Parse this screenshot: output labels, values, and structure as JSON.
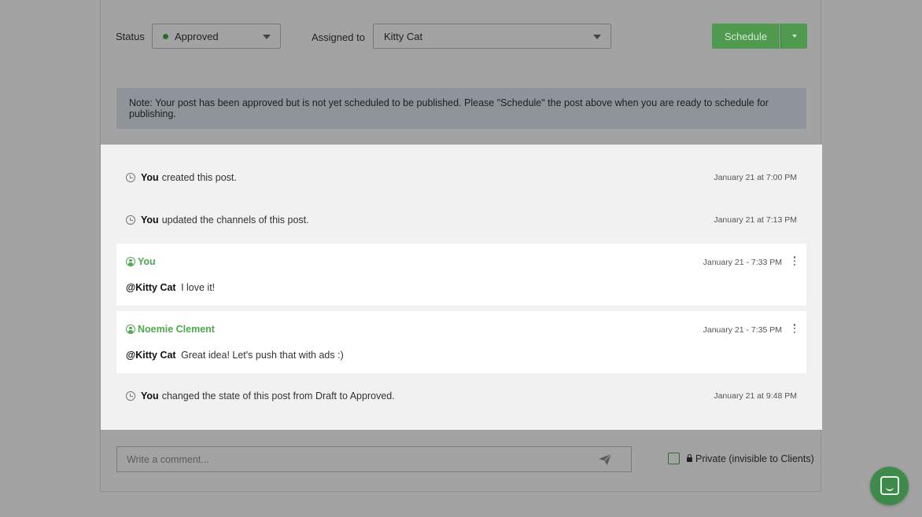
{
  "toolbar": {
    "status_label": "Status",
    "status_value": "Approved",
    "status_color": "#2f6b2f",
    "assigned_label": "Assigned to",
    "assigned_value": "Kitty Cat",
    "schedule_label": "Schedule"
  },
  "note": {
    "text": "Note: Your post has been approved but is not yet scheduled to be published. Please \"Schedule\" the post above when you are ready to schedule for publishing."
  },
  "activity": [
    {
      "actor": "You",
      "text": "created this post.",
      "time": "January 21 at 7:00 PM"
    },
    {
      "actor": "You",
      "text": "updated the channels of this post.",
      "time": "January 21 at 7:13 PM"
    }
  ],
  "comments": [
    {
      "author": "You",
      "time": "January 21 - 7:33 PM",
      "mention": "@Kitty Cat",
      "text": "I love it!"
    },
    {
      "author": "Noemie Clement",
      "time": "January 21 - 7:35 PM",
      "mention": "@Kitty Cat",
      "text": "Great idea! Let's push that with ads :)"
    }
  ],
  "state_change": {
    "actor": "You",
    "text": "changed the state of this post from Draft to Approved.",
    "time": "January 21 at 9:48 PM"
  },
  "composer": {
    "placeholder": "Write a comment...",
    "private_label": "Private (invisible to Clients)"
  },
  "colors": {
    "accent": "#4f9a4f",
    "author": "#4ea84e"
  },
  "icons": [
    "chevron-down-icon",
    "clock-icon",
    "user-icon",
    "more-vertical-icon",
    "send-icon",
    "lock-icon",
    "chat-icon"
  ]
}
